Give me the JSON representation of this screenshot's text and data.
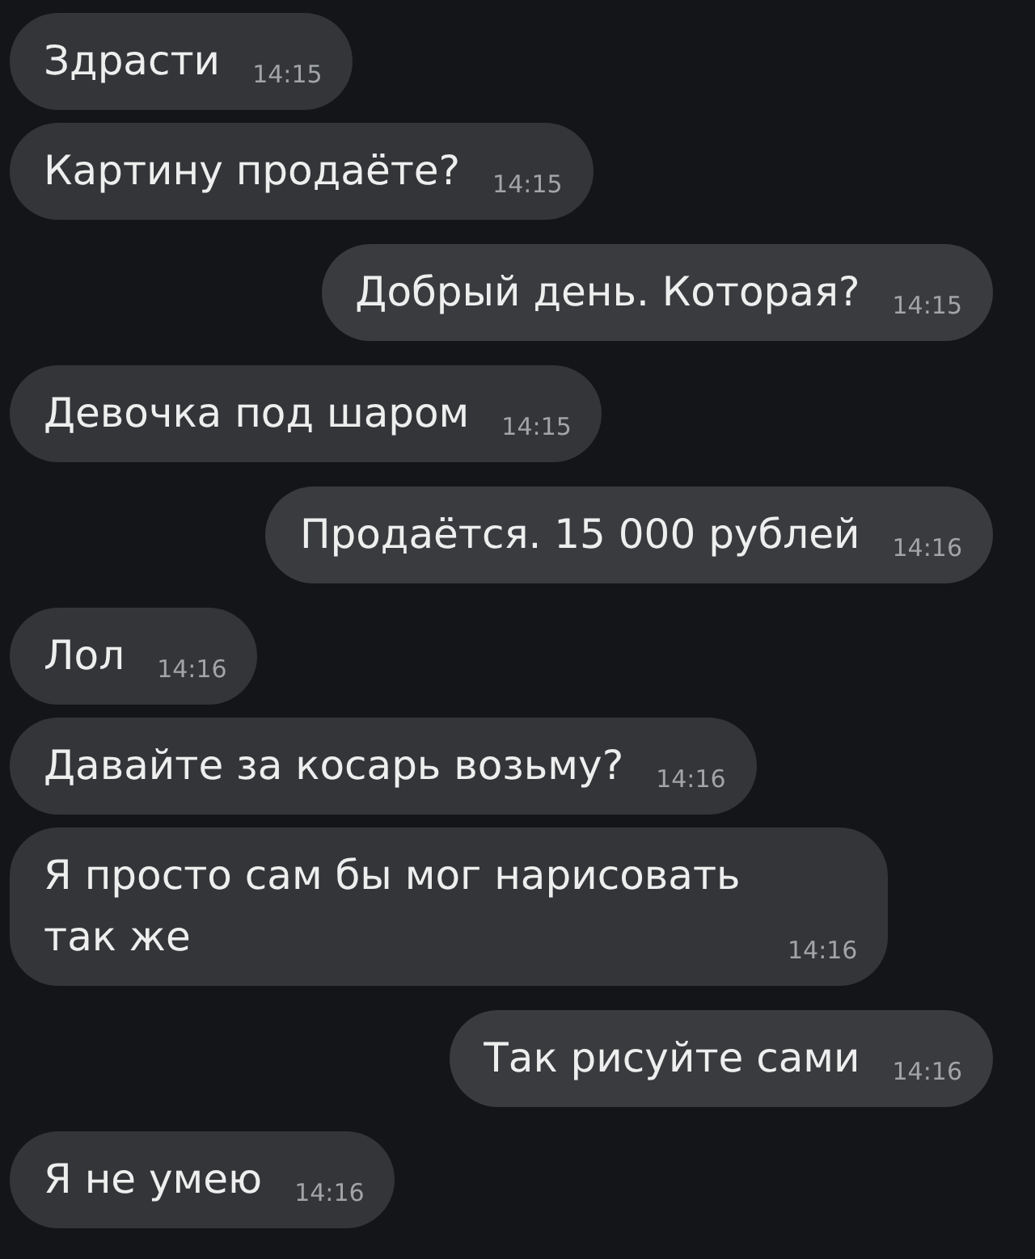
{
  "messages": [
    {
      "kind": "incoming",
      "text": "Здрасти",
      "time": "14:15"
    },
    {
      "kind": "incoming",
      "text": "Картину продаёте?",
      "time": "14:15"
    },
    {
      "kind": "outgoing",
      "text": "Добрый день. Которая?",
      "time": "14:15"
    },
    {
      "kind": "incoming",
      "text": "Девочка под шаром",
      "time": "14:15"
    },
    {
      "kind": "outgoing",
      "text": "Продаётся. 15 000 рублей",
      "time": "14:16"
    },
    {
      "kind": "incoming",
      "text": "Лол",
      "time": "14:16"
    },
    {
      "kind": "incoming",
      "text": "Давайте за косарь возьму?",
      "time": "14:16"
    },
    {
      "kind": "incoming",
      "text": "Я просто сам бы мог нарисовать так же",
      "time": "14:16"
    },
    {
      "kind": "outgoing",
      "text": "Так рисуйте сами",
      "time": "14:16"
    },
    {
      "kind": "incoming",
      "text": "Я не умею",
      "time": "14:16"
    }
  ]
}
